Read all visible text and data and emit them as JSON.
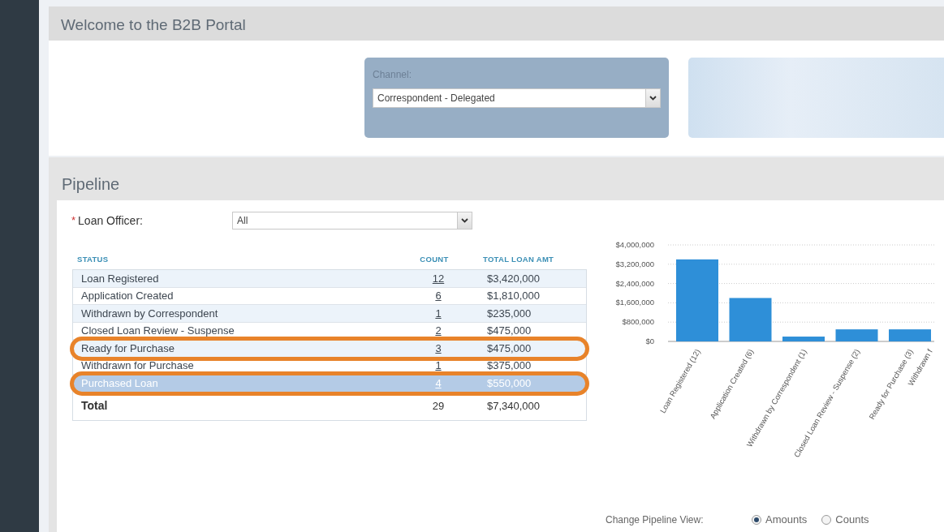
{
  "header": {
    "title": "Welcome to the B2B Portal"
  },
  "channel": {
    "label": "Channel:",
    "value": "Correspondent - Delegated"
  },
  "pipeline": {
    "title": "Pipeline",
    "loan_officer": {
      "required_mark": "*",
      "label": "Loan Officer:",
      "value": "All"
    },
    "table": {
      "columns": [
        "STATUS",
        "COUNT",
        "TOTAL LOAN AMT"
      ],
      "rows": [
        {
          "status": "Loan Registered",
          "count": "12",
          "amount": "$3,420,000",
          "selected": false,
          "highlighted": false
        },
        {
          "status": "Application Created",
          "count": "6",
          "amount": "$1,810,000",
          "selected": false,
          "highlighted": false
        },
        {
          "status": "Withdrawn by Correspondent",
          "count": "1",
          "amount": "$235,000",
          "selected": false,
          "highlighted": false
        },
        {
          "status": "Closed Loan Review - Suspense",
          "count": "2",
          "amount": "$475,000",
          "selected": false,
          "highlighted": false
        },
        {
          "status": "Ready for Purchase",
          "count": "3",
          "amount": "$475,000",
          "selected": false,
          "highlighted": true
        },
        {
          "status": "Withdrawn for Purchase",
          "count": "1",
          "amount": "$375,000",
          "selected": false,
          "highlighted": false
        },
        {
          "status": "Purchased Loan",
          "count": "4",
          "amount": "$550,000",
          "selected": true,
          "highlighted": true
        }
      ],
      "total": {
        "label": "Total",
        "count": "29",
        "amount": "$7,340,000"
      }
    },
    "chart_data": {
      "type": "bar",
      "categories": [
        "Loan Registered (12)",
        "Application Created (6)",
        "Withdrawn by Correspondent (1)",
        "Closed Loan Review - Suspense (2)",
        "Ready for Purchase (3)",
        "Withdrawn f"
      ],
      "series": [
        {
          "color": "#2e8fd8",
          "values": [
            3400000,
            1800000,
            200000,
            500000,
            500000,
            null
          ]
        }
      ],
      "grid": true,
      "ylim": [
        0,
        4000000
      ],
      "yticks": [
        {
          "value": 0,
          "label": "$0"
        },
        {
          "value": 800000,
          "label": "$800,000"
        },
        {
          "value": 1600000,
          "label": "$1,600,000"
        },
        {
          "value": 2400000,
          "label": "$2,400,000"
        },
        {
          "value": 3200000,
          "label": "$3,200,000"
        },
        {
          "value": 4000000,
          "label": "$4,000,000"
        }
      ]
    },
    "view": {
      "label": "Change Pipeline View:",
      "options": [
        {
          "label": "Amounts",
          "selected": true
        },
        {
          "label": "Counts",
          "selected": false
        }
      ]
    }
  }
}
